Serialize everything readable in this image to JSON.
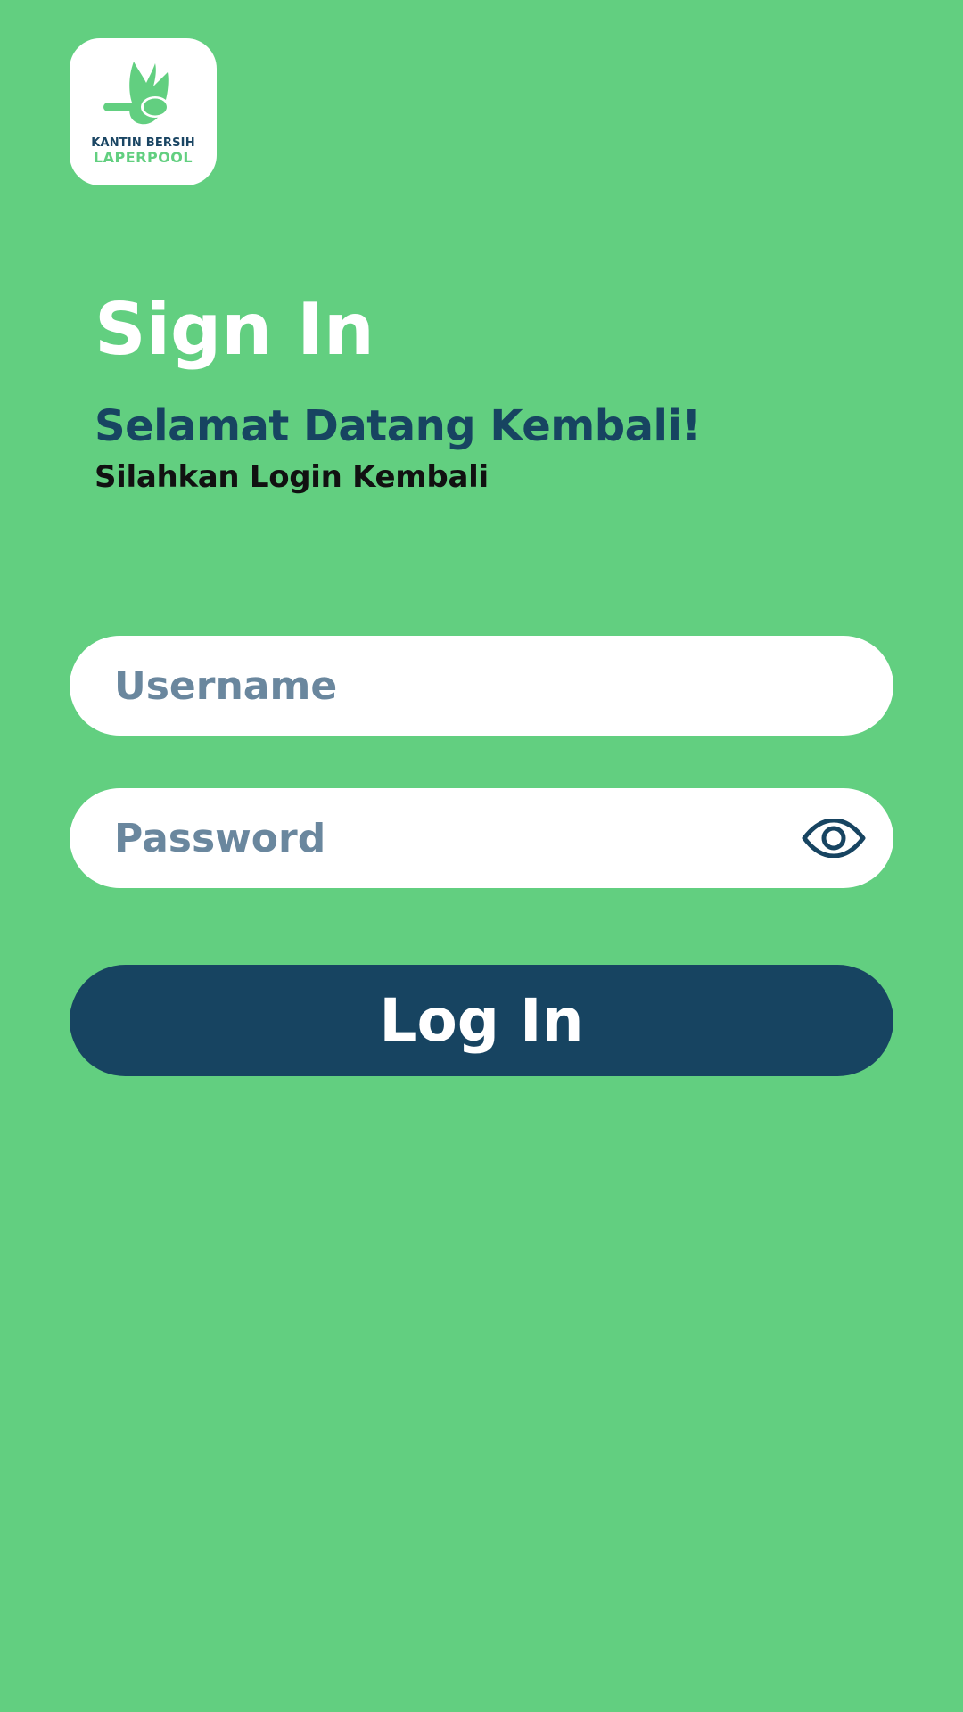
{
  "logo": {
    "line1": "KANTIN BERSIH",
    "line2": "LAPERPOOL",
    "icon": "hand-spoon-logo-icon"
  },
  "title": "Sign In",
  "welcome": "Selamat Datang Kembali!",
  "subtitle": "Silahkan Login Kembali",
  "form": {
    "username": {
      "value": "",
      "placeholder": "Username"
    },
    "password": {
      "value": "",
      "placeholder": "Password",
      "toggle_icon": "eye-icon"
    },
    "login_label": "Log In"
  },
  "colors": {
    "background": "#62cf80",
    "primary": "#174461",
    "field_background": "#ffffff",
    "placeholder": "#6a879e",
    "title": "#ffffff",
    "subtitle": "#111111"
  }
}
